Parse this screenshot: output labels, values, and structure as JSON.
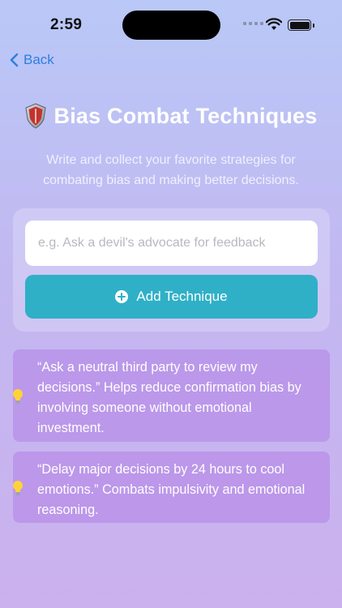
{
  "status_bar": {
    "time": "2:59"
  },
  "nav": {
    "back_label": "Back"
  },
  "header": {
    "title": "Bias Combat Techniques",
    "subtitle": "Write and collect your favorite strategies for combating bias and making better decisions."
  },
  "form": {
    "input_value": "",
    "input_placeholder": "e.g. Ask a devil's advocate for feedback",
    "add_label": "Add Technique"
  },
  "techniques": [
    {
      "text": "“Ask a neutral third party to review my decisions.” Helps reduce confirmation bias by involving someone without emotional investment.",
      "icon": "lightbulb-icon"
    },
    {
      "text": "“Delay major decisions by 24 hours to cool emotions.” Combats impulsivity and emotional reasoning.",
      "icon": "lightbulb-icon"
    }
  ],
  "icons": {
    "header_icon": "shield-icon",
    "back_icon": "chevron-left-icon",
    "add_icon": "plus-circle-icon"
  },
  "colors": {
    "accent": "#2fb0c7",
    "link": "#2f7de0",
    "card": "#b280e6"
  }
}
